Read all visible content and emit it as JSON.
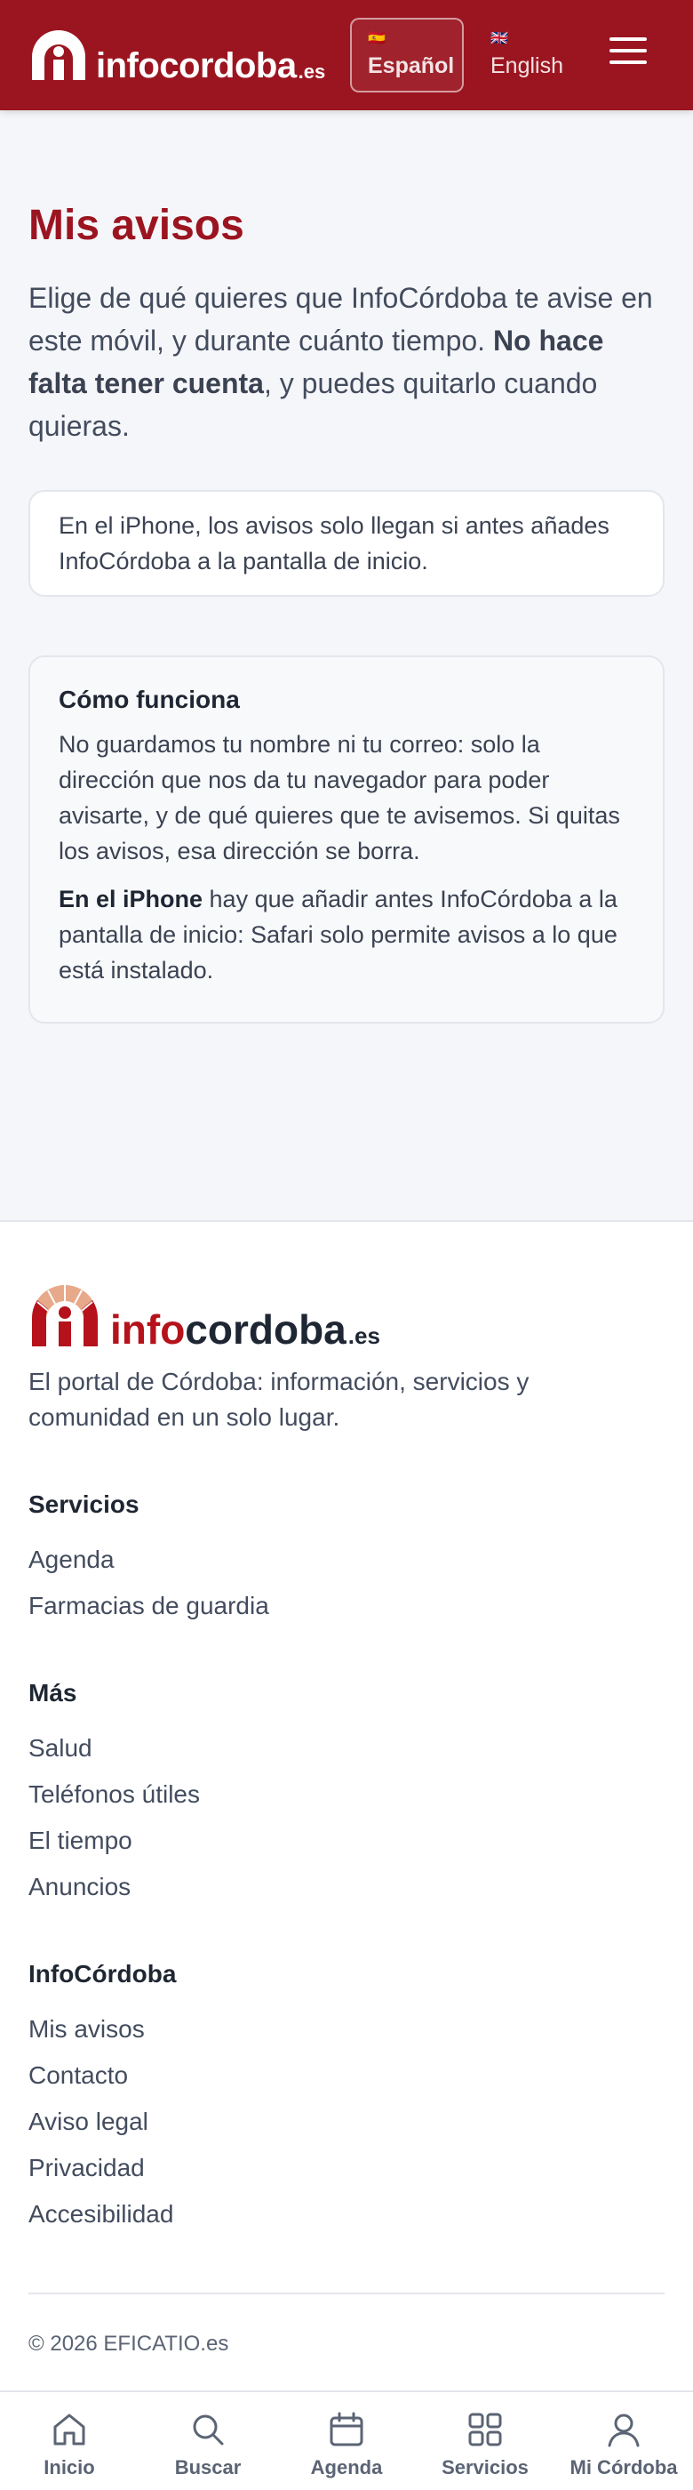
{
  "header": {
    "brand": "infocordoba",
    "brand_tld": ".es",
    "languages": [
      {
        "label": "Español",
        "flag": "🇪🇸",
        "active": true
      },
      {
        "label": "English",
        "flag": "🇬🇧",
        "active": false
      }
    ],
    "menu_icon": "hamburger-menu-icon"
  },
  "main": {
    "title": "Mis avisos",
    "intro_part1": "Elige de qué quieres que InfoCórdoba te avise en este móvil, y durante cuánto tiempo. ",
    "intro_bold": "No hace falta tener cuenta",
    "intro_part2": ", y puedes quitarlo cuando quieras.",
    "notice": "En el iPhone, los avisos solo llegan si antes añades InfoCórdoba a la pantalla de inicio.",
    "how": {
      "title": "Cómo funciona",
      "p1": "No guardamos tu nombre ni tu correo: solo la dirección que nos da tu navegador para poder avisarte, y de qué quieres que te avisemos. Si quitas los avisos, esa dirección se borra.",
      "p2_bold": "En el iPhone",
      "p2_rest": " hay que añadir antes InfoCórdoba a la pantalla de inicio: Safari solo permite avisos a lo que está instalado."
    }
  },
  "footer": {
    "brand_info": "info",
    "brand_cordoba": "cordoba",
    "brand_tld": ".es",
    "tagline": "El portal de Córdoba: información, servicios y comunidad en un solo lugar.",
    "sections": [
      {
        "title": "Servicios",
        "links": [
          "Agenda",
          "Farmacias de guardia"
        ]
      },
      {
        "title": "Más",
        "links": [
          "Salud",
          "Teléfonos útiles",
          "El tiempo",
          "Anuncios"
        ]
      },
      {
        "title": "InfoCórdoba",
        "links": [
          "Mis avisos",
          "Contacto",
          "Aviso legal",
          "Privacidad",
          "Accesibilidad"
        ]
      }
    ],
    "copyright": "© 2026 EFICATIO.es"
  },
  "bottom_nav": [
    {
      "label": "Inicio",
      "icon": "home-icon"
    },
    {
      "label": "Buscar",
      "icon": "search-icon"
    },
    {
      "label": "Agenda",
      "icon": "calendar-icon"
    },
    {
      "label": "Servicios",
      "icon": "grid-icon"
    },
    {
      "label": "Mi Córdoba",
      "icon": "user-icon"
    }
  ],
  "colors": {
    "brand_red": "#9b1520",
    "logo_red": "#b5121b",
    "logo_peach": "#e8a98a",
    "background": "#f5f6f9"
  }
}
